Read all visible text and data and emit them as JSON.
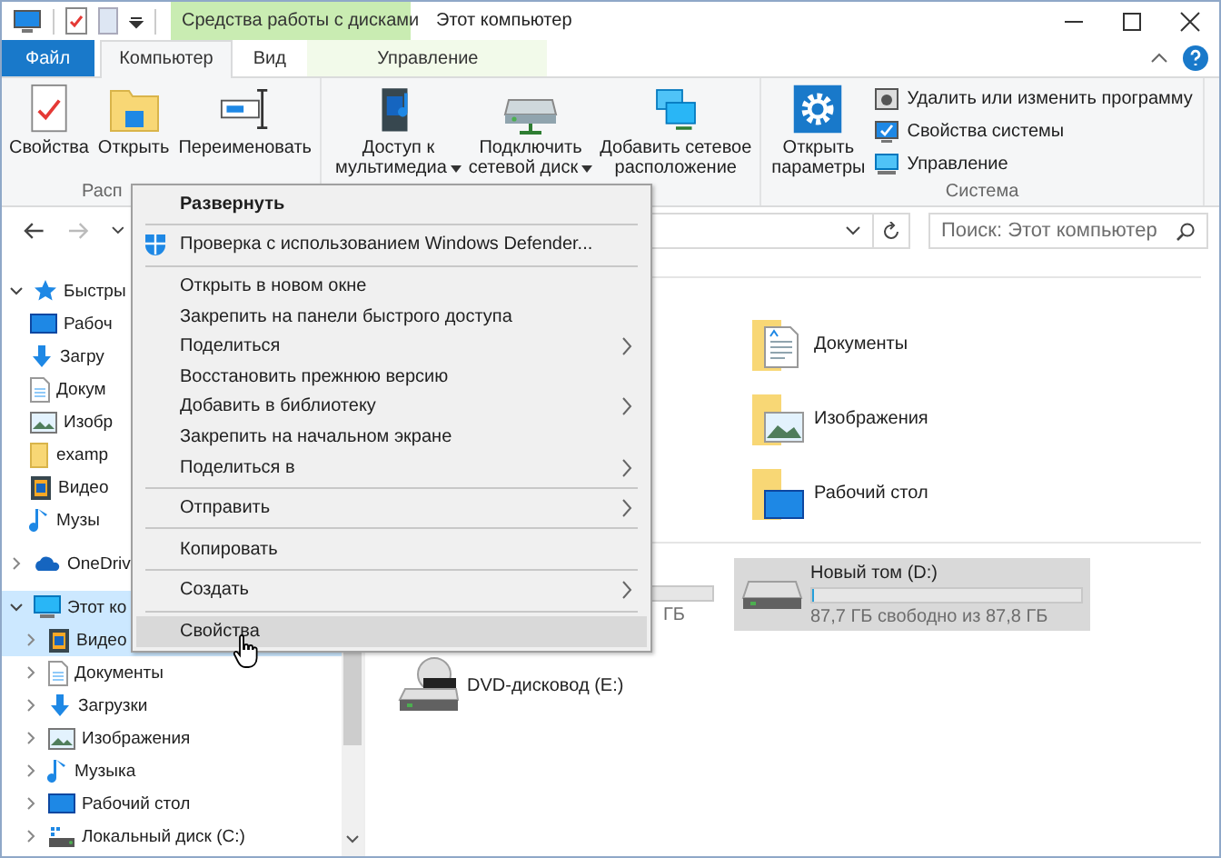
{
  "title_bar": {
    "title": "Этот компьютер",
    "contextual_group": "Средства работы с дисками"
  },
  "ribbon_tabs": [
    {
      "label": "Файл",
      "kind": "file",
      "selected": false
    },
    {
      "label": "Компьютер",
      "kind": "tab",
      "selected": true
    },
    {
      "label": "Вид",
      "kind": "tab",
      "selected": false
    },
    {
      "label": "Управление",
      "kind": "contextual",
      "selected": false
    }
  ],
  "ribbon_groups": [
    {
      "label": "Расп",
      "large": [
        {
          "kind": "properties",
          "lines": [
            "Свойства"
          ],
          "dropdown": false
        },
        {
          "kind": "open",
          "lines": [
            "Открыть"
          ],
          "dropdown": false
        },
        {
          "kind": "rename",
          "lines": [
            "Переименовать"
          ],
          "dropdown": false
        }
      ]
    },
    {
      "large": [
        {
          "kind": "media",
          "lines": [
            "Доступ к",
            "мультимедиа"
          ],
          "dropdown": true
        },
        {
          "kind": "map-drive",
          "lines": [
            "Подключить",
            "сетевой диск"
          ],
          "dropdown": true
        },
        {
          "kind": "add-location",
          "lines": [
            "Добавить сетевое",
            "расположение"
          ],
          "dropdown": false
        }
      ]
    },
    {
      "label": "Система",
      "large": [
        {
          "kind": "settings",
          "lines": [
            "Открыть",
            "параметры"
          ],
          "dropdown": false
        }
      ],
      "small": [
        {
          "kind": "uninstall",
          "label": "Удалить или изменить программу"
        },
        {
          "kind": "system",
          "label": "Свойства системы"
        },
        {
          "kind": "manage",
          "label": "Управление"
        }
      ]
    }
  ],
  "search": {
    "placeholder": "Поиск: Этот компьютер"
  },
  "nav_tree": [
    {
      "kind": "quick",
      "label": "Быстры",
      "expanded": true,
      "selected": false,
      "children": [
        {
          "kind": "desktop",
          "label": "Рабоч",
          "selected": false
        },
        {
          "kind": "downloads",
          "label": "Загру",
          "selected": false
        },
        {
          "kind": "documents",
          "label": "Докум",
          "selected": false
        },
        {
          "kind": "pictures",
          "label": "Изобр",
          "selected": false
        },
        {
          "kind": "folder",
          "label": "examp",
          "selected": false
        },
        {
          "kind": "videos",
          "label": "Видео",
          "selected": false
        },
        {
          "kind": "music",
          "label": "Музы",
          "selected": false
        }
      ]
    },
    {
      "kind": "onedrive",
      "label": "OneDriv",
      "expanded": false,
      "selected": false
    },
    {
      "kind": "computer",
      "label": "Этот ко",
      "expanded": true,
      "selected": true,
      "children": [
        {
          "kind": "videos",
          "label": "Видео",
          "expanded": false,
          "selected": true
        },
        {
          "kind": "documents",
          "label": "Документы",
          "expanded": false,
          "selected": false
        },
        {
          "kind": "downloads",
          "label": "Загрузки",
          "expanded": false,
          "selected": false
        },
        {
          "kind": "pictures",
          "label": "Изображения",
          "expanded": false,
          "selected": false
        },
        {
          "kind": "music",
          "label": "Музыка",
          "expanded": false,
          "selected": false
        },
        {
          "kind": "desktop",
          "label": "Рабочий стол",
          "expanded": false,
          "selected": false
        },
        {
          "kind": "drive",
          "label": "Локальный диск (C:)",
          "expanded": false,
          "selected": false
        }
      ]
    }
  ],
  "folders": [
    {
      "kind": "documents",
      "name": "Документы"
    },
    {
      "kind": "pictures",
      "name": "Изображения"
    },
    {
      "kind": "desktop",
      "name": "Рабочий стол"
    }
  ],
  "drive_behind_menu": {
    "free": "ГБ",
    "level": 0.02
  },
  "drives": [
    {
      "kind": "hdd",
      "name": "Новый том (D:)",
      "free": "87,7 ГБ свободно из 87,8 ГБ",
      "level": 0.01,
      "selected": true
    },
    {
      "kind": "dvd",
      "name": "DVD-дисковод (E:)",
      "selected": false
    }
  ],
  "context_menu": [
    {
      "kind": "item",
      "label": "Развернуть",
      "default": true,
      "submenu": false,
      "highlighted": false
    },
    {
      "kind": "separator"
    },
    {
      "kind": "shielded",
      "label": "Проверка с использованием Windows Defender...",
      "default": false,
      "submenu": false,
      "highlighted": false
    },
    {
      "kind": "separator"
    },
    {
      "kind": "item",
      "label": "Открыть в новом окне",
      "default": false,
      "submenu": false,
      "highlighted": false
    },
    {
      "kind": "item",
      "label": "Закрепить на панели быстрого доступа",
      "default": false,
      "submenu": false,
      "highlighted": false
    },
    {
      "kind": "item",
      "label": "Поделиться",
      "default": false,
      "submenu": true,
      "highlighted": false
    },
    {
      "kind": "item",
      "label": "Восстановить прежнюю версию",
      "default": false,
      "submenu": false,
      "highlighted": false
    },
    {
      "kind": "item",
      "label": "Добавить в библиотеку",
      "default": false,
      "submenu": true,
      "highlighted": false
    },
    {
      "kind": "item",
      "label": "Закрепить на начальном экране",
      "default": false,
      "submenu": false,
      "highlighted": false
    },
    {
      "kind": "item",
      "label": "Поделиться в",
      "default": false,
      "submenu": true,
      "highlighted": false
    },
    {
      "kind": "separator"
    },
    {
      "kind": "item",
      "label": "Отправить",
      "default": false,
      "submenu": true,
      "highlighted": false
    },
    {
      "kind": "separator"
    },
    {
      "kind": "item",
      "label": "Копировать",
      "default": false,
      "submenu": false,
      "highlighted": false
    },
    {
      "kind": "separator"
    },
    {
      "kind": "item",
      "label": "Создать",
      "default": false,
      "submenu": true,
      "highlighted": false
    },
    {
      "kind": "separator"
    },
    {
      "kind": "item",
      "label": "Свойства",
      "default": false,
      "submenu": false,
      "highlighted": true
    }
  ]
}
